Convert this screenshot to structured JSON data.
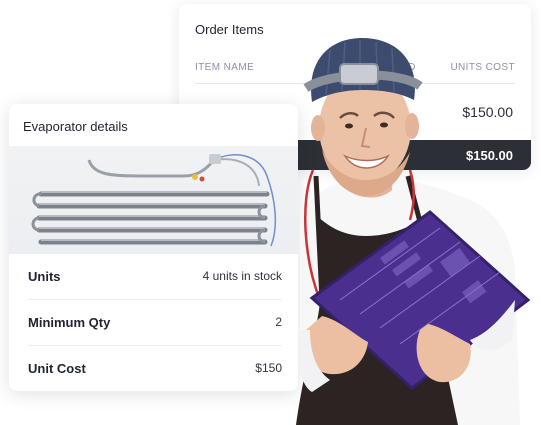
{
  "order_items": {
    "title": "Order Items",
    "columns": [
      "ITEM NAME",
      "ED",
      "UNITS COST"
    ],
    "row_price": "$150.00",
    "total": "$150.00"
  },
  "evaporator": {
    "title": "Evaporator details",
    "details": [
      {
        "label": "Units",
        "value": "4 units in stock"
      },
      {
        "label": "Minimum Qty",
        "value": "2"
      },
      {
        "label": "Unit Cost",
        "value": "$150"
      }
    ]
  },
  "colors": {
    "total_bar": "#2c2f35",
    "beanie": "#3d4c6e",
    "circuit_board": "#4b2f8f",
    "apron": "#2b2422"
  }
}
